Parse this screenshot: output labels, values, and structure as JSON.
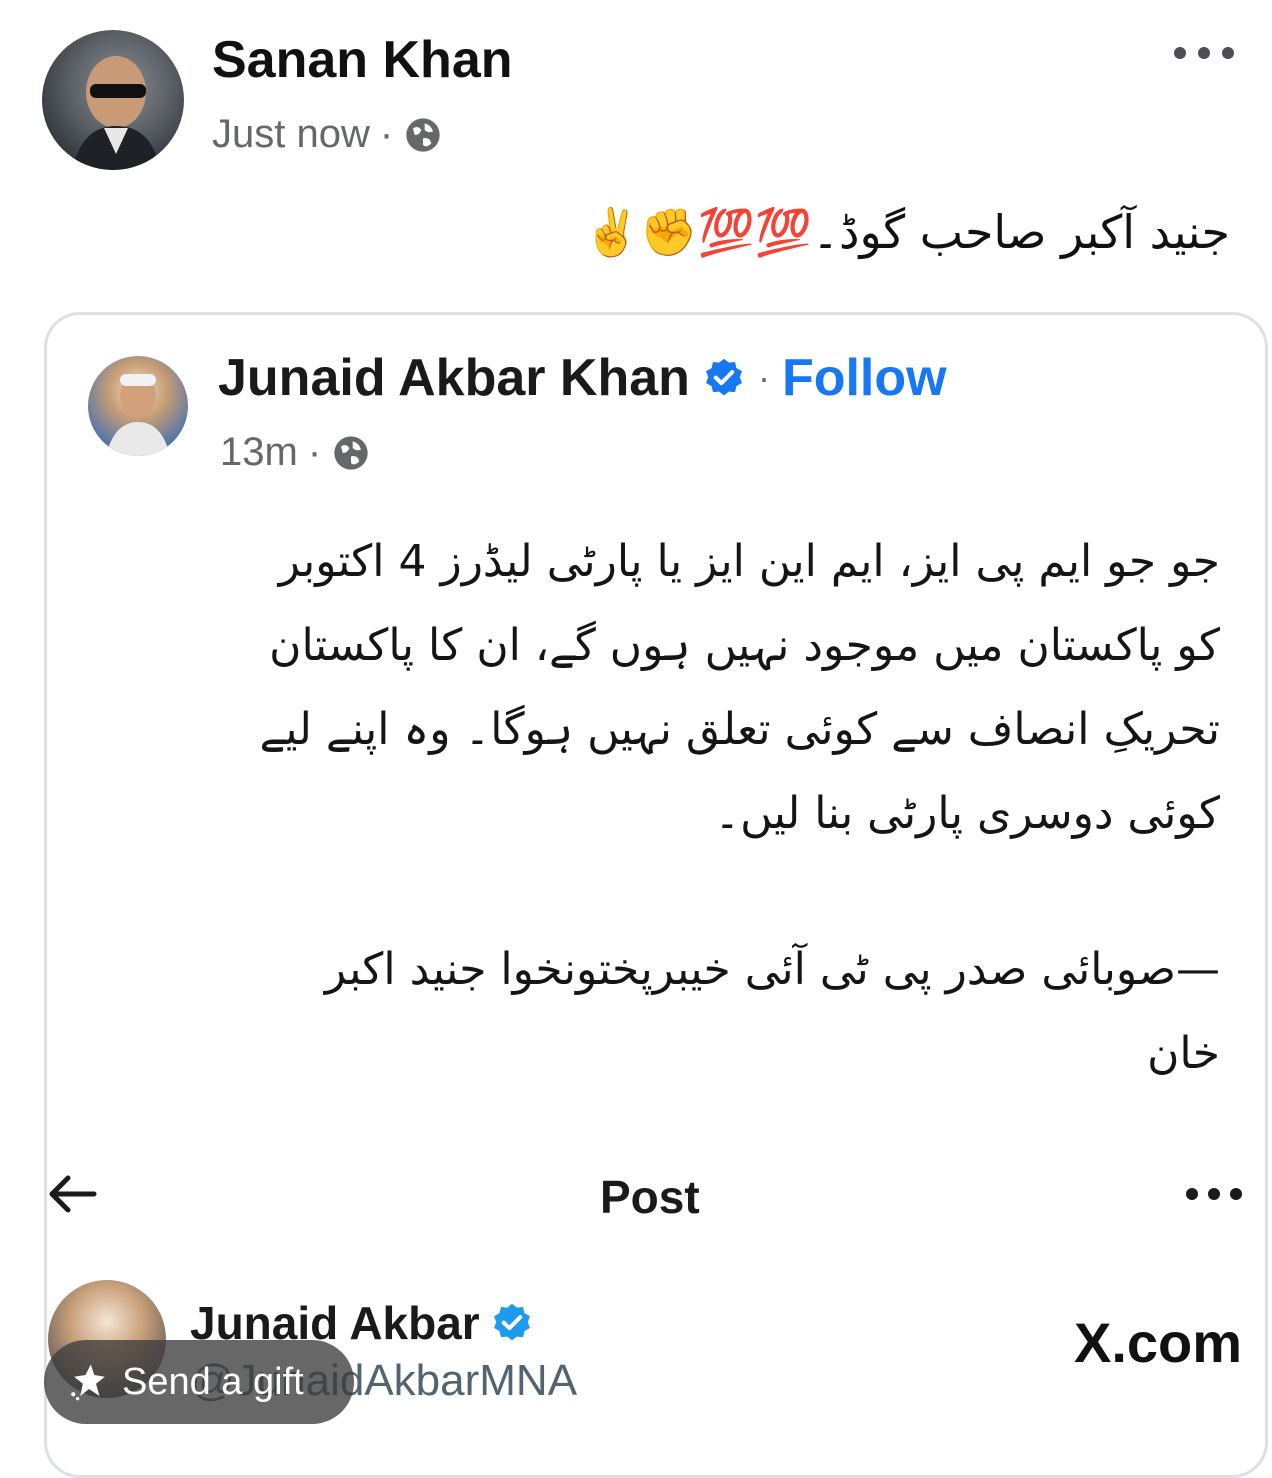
{
  "post": {
    "author": "Sanan Khan",
    "time": "Just now",
    "privacy_icon": "globe-icon",
    "caption": "جنید آکبر صاحب گوڈ۔",
    "caption_emojis": "💯💯✊✌️"
  },
  "shared_card": {
    "author": "Junaid Akbar Khan",
    "verified": true,
    "separator": "·",
    "follow_label": "Follow",
    "time": "13m",
    "urdu_lines": [
      "جو جو ایم پی ایز، ایم این ایز یا پارٹی لیڈرز 4 اکتوبر",
      "کو پاکستان میں موجود نہیں ہوں گے، ان کا پاکستان",
      "تحریکِ انصاف سے کوئی تعلق نہیں ہوگا۔ وہ اپنے لیے",
      "کوئی دوسری پارٹی بنا لیں۔"
    ],
    "signature_lines": [
      "—صوبائی صدر پی ٹی آئی  خیبرپختونخوا جنید اکبر",
      "خان"
    ]
  },
  "embedded_x": {
    "title": "Post",
    "name": "Junaid Akbar",
    "handle": "@JunaidAkbarMNA",
    "brand": "X.com"
  },
  "gift_button": {
    "label": "Send a gift"
  },
  "colors": {
    "accent": "#1877f2",
    "meta": "#65676b",
    "card_border": "#dde0e4"
  }
}
